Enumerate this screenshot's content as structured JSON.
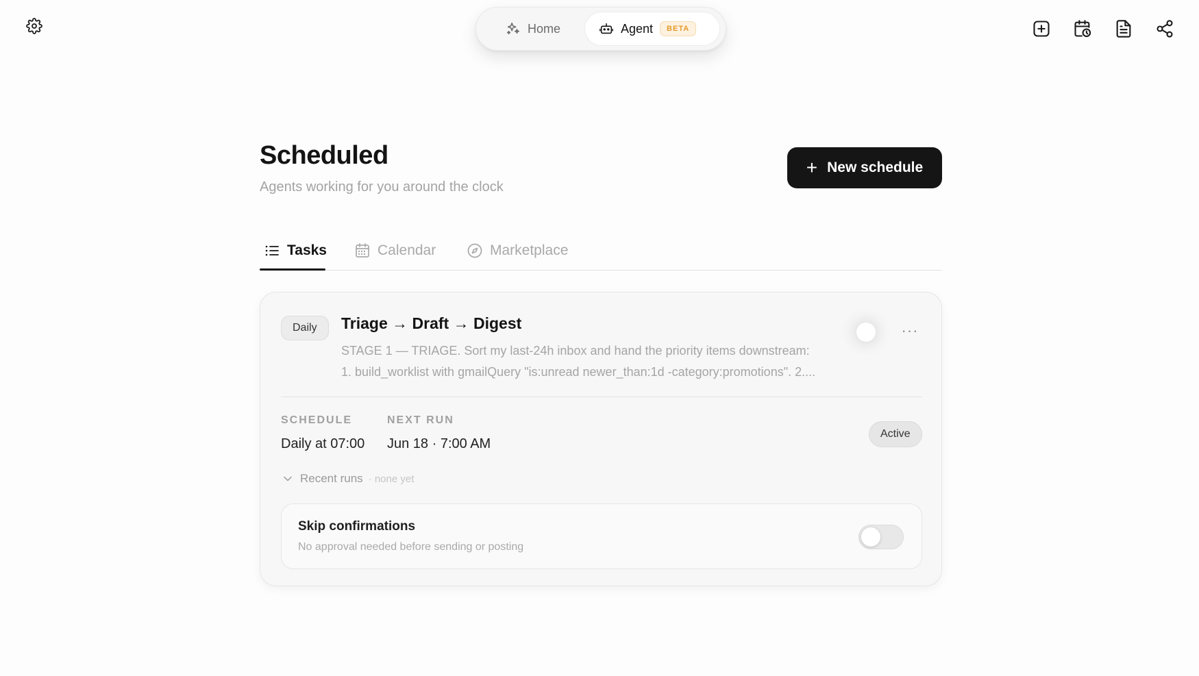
{
  "nav": {
    "home_label": "Home",
    "agent_label": "Agent",
    "agent_badge": "BETA"
  },
  "icons": {
    "settings": "gear-icon",
    "home": "sparkles-icon",
    "agent": "robot-icon",
    "new_chat": "plus-square-icon",
    "scheduled": "calendar-clock-icon",
    "document": "file-text-icon",
    "share": "share-icon"
  },
  "header": {
    "title": "Scheduled",
    "subtitle": "Agents working for you around the clock",
    "new_button_label": "New schedule"
  },
  "tabs": [
    {
      "label": "Tasks",
      "active": true
    },
    {
      "label": "Calendar",
      "active": false
    },
    {
      "label": "Marketplace",
      "active": false
    }
  ],
  "task": {
    "frequency": "Daily",
    "title": "Triage → Draft → Digest",
    "description": "STAGE 1 — TRIAGE. Sort my last-24h inbox and hand the priority items downstream: 1. build_worklist with gmailQuery \"is:unread newer_than:1d -category:promotions\". 2....",
    "enabled": false,
    "more_label": "···",
    "schedule_label": "SCHEDULE",
    "schedule_value": "Daily at 07:00",
    "next_run_label": "NEXT RUN",
    "next_run_value": "Jun 18 · 7:00 AM",
    "status": "Active",
    "recent_runs_label": "Recent runs",
    "recent_runs_sub": "· none yet",
    "skip": {
      "title": "Skip confirmations",
      "subtitle": "No approval needed before sending or posting",
      "enabled": false
    }
  },
  "colors": {
    "primary_button": "#151515",
    "beta_text": "#e59a2a",
    "beta_bg": "#fdf1df"
  }
}
